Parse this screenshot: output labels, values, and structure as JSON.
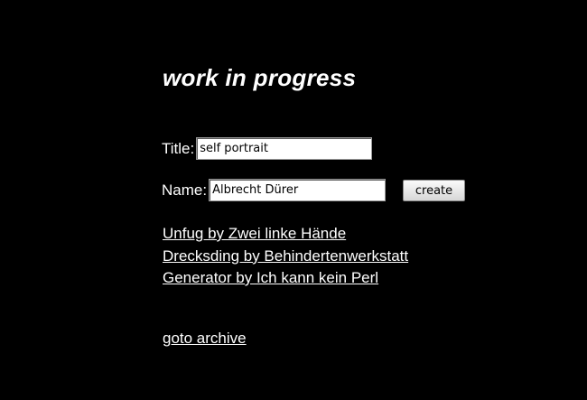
{
  "page": {
    "heading": "work in progress"
  },
  "form": {
    "title_label": "Title:",
    "title_value": "self portrait",
    "name_label": "Name:",
    "name_value": "Albrecht Dürer",
    "create_label": "create"
  },
  "links": [
    "Unfug by Zwei linke Hände",
    "Drecksding by Behindertenwerkstatt",
    "Generator by Ich kann kein Perl"
  ],
  "archive_link": "goto archive"
}
